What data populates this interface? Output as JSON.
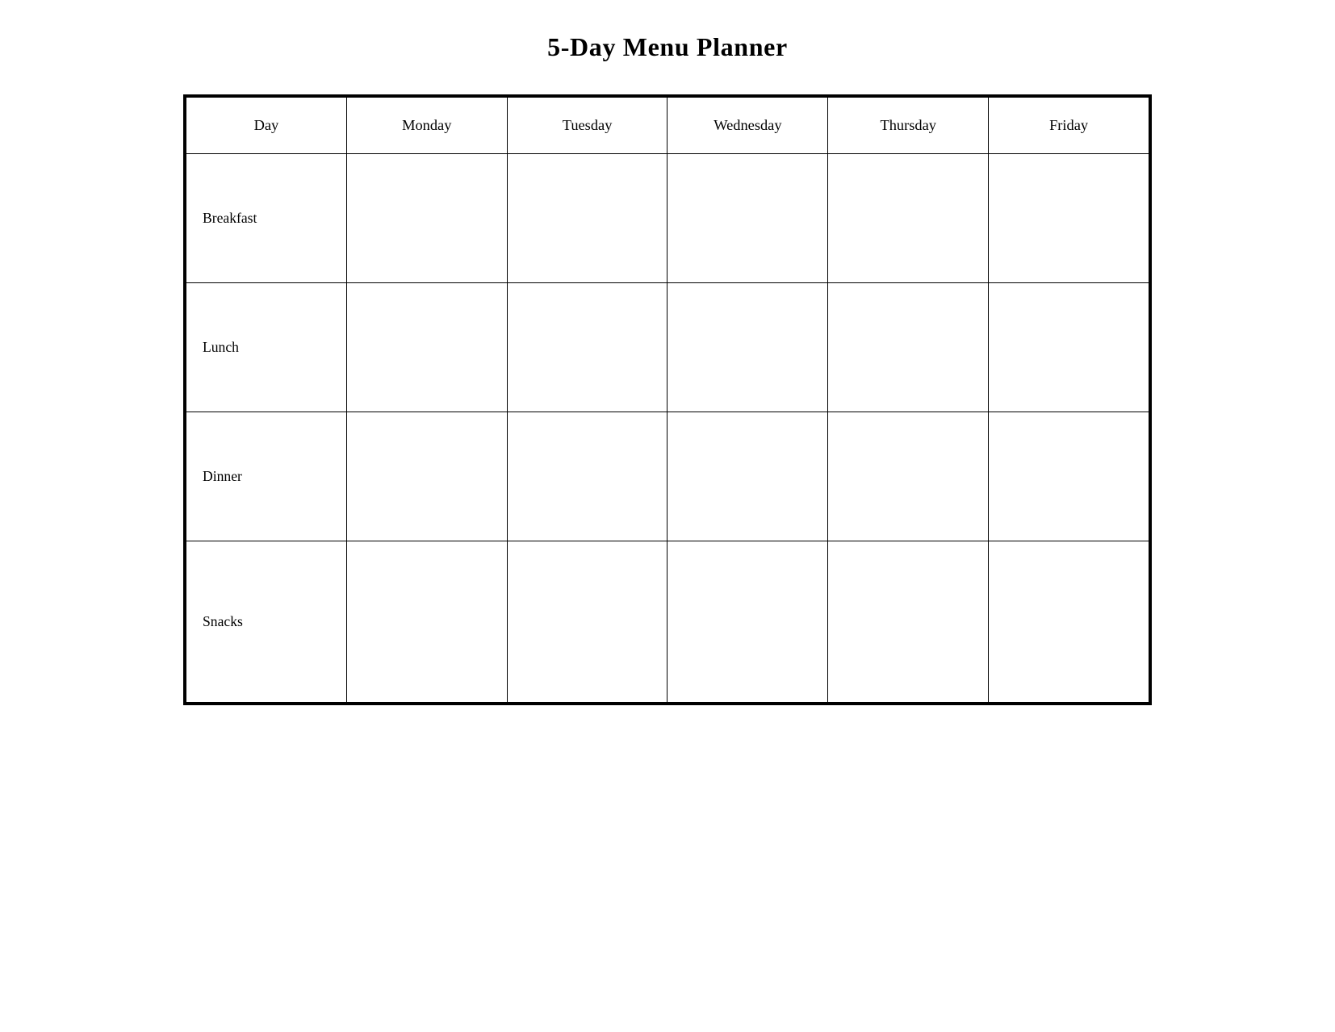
{
  "title": "5-Day Menu Planner",
  "columns": {
    "day": "Day",
    "monday": "Monday",
    "tuesday": "Tuesday",
    "wednesday": "Wednesday",
    "thursday": "Thursday",
    "friday": "Friday"
  },
  "rows": {
    "breakfast": "Breakfast",
    "lunch": "Lunch",
    "dinner": "Dinner",
    "snacks": "Snacks"
  }
}
